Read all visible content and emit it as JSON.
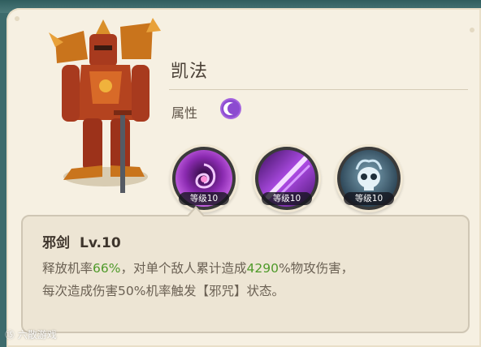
{
  "hero": {
    "name": "凯法",
    "attribute_label": "属性",
    "attribute_icon": "crescent-moon-icon",
    "attribute_color": "#9b58d6"
  },
  "skills": [
    {
      "icon": "evil-sword-vortex-icon",
      "level_label": "等级10"
    },
    {
      "icon": "purple-slash-icon",
      "level_label": "等级10"
    },
    {
      "icon": "skull-curse-icon",
      "level_label": "等级10"
    }
  ],
  "tooltip": {
    "skill_name": "邪剑",
    "level": "Lv.10",
    "line1": {
      "prefix": "释放机率",
      "chance": "66%",
      "middle": "，对单个敌人累计造成",
      "damage": "4290",
      "suffix": "%物攻伤害，"
    },
    "line2": "每次造成伤害50%机率触发【邪咒】状态。"
  },
  "watermark": "⑮ 六散游戏",
  "colors": {
    "highlight": "#4f9a2a",
    "panel_bg": "#f6f0e2",
    "tooltip_bg": "#ede5d4"
  }
}
